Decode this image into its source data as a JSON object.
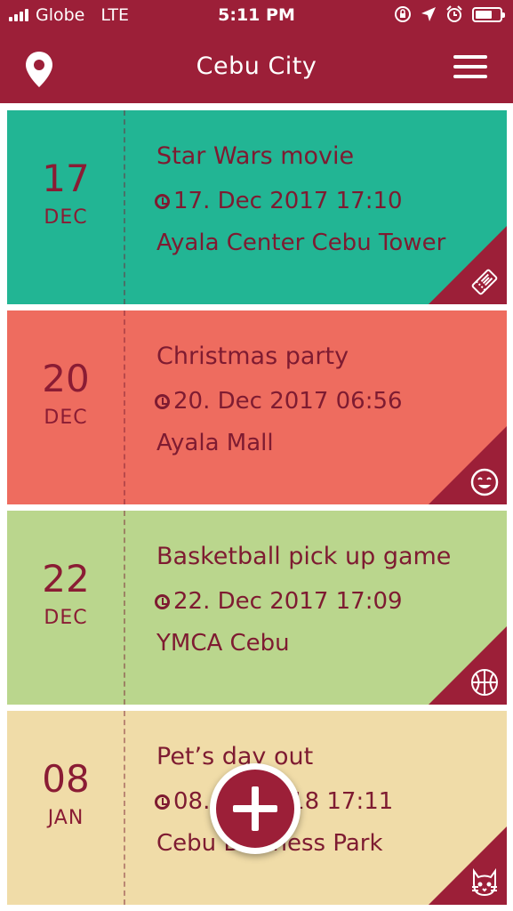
{
  "status_bar": {
    "carrier": "Globe",
    "network": "LTE",
    "time": "5:11 PM",
    "battery_level": 0.7
  },
  "header": {
    "title": "Cebu City",
    "location_icon": "map-pin-icon",
    "menu_icon": "hamburger-menu-icon"
  },
  "events": [
    {
      "day": "17",
      "month": "DEC",
      "title": "Star Wars movie",
      "datetime": "17. Dec 2017 17:10",
      "location": "Ayala Center Cebu Tower",
      "icon": "ticket-icon",
      "color": "#22b594"
    },
    {
      "day": "20",
      "month": "DEC",
      "title": "Christmas party",
      "datetime": "20. Dec 2017 06:56",
      "location": "Ayala Mall",
      "icon": "smiley-icon",
      "color": "#ee6c5f"
    },
    {
      "day": "22",
      "month": "DEC",
      "title": "Basketball pick up game",
      "datetime": "22. Dec 2017 17:09",
      "location": "YMCA Cebu",
      "icon": "basketball-icon",
      "color": "#bad68d"
    },
    {
      "day": "08",
      "month": "JAN",
      "title": "Pet’s day out",
      "datetime": "08. Jan 2018 17:11",
      "location": "Cebu Business Park",
      "icon": "cat-icon",
      "color": "#f0dca8"
    }
  ],
  "colors": {
    "brand": "#9c1f38",
    "text": "#7e1b31"
  },
  "fab": {
    "icon": "add-icon"
  }
}
